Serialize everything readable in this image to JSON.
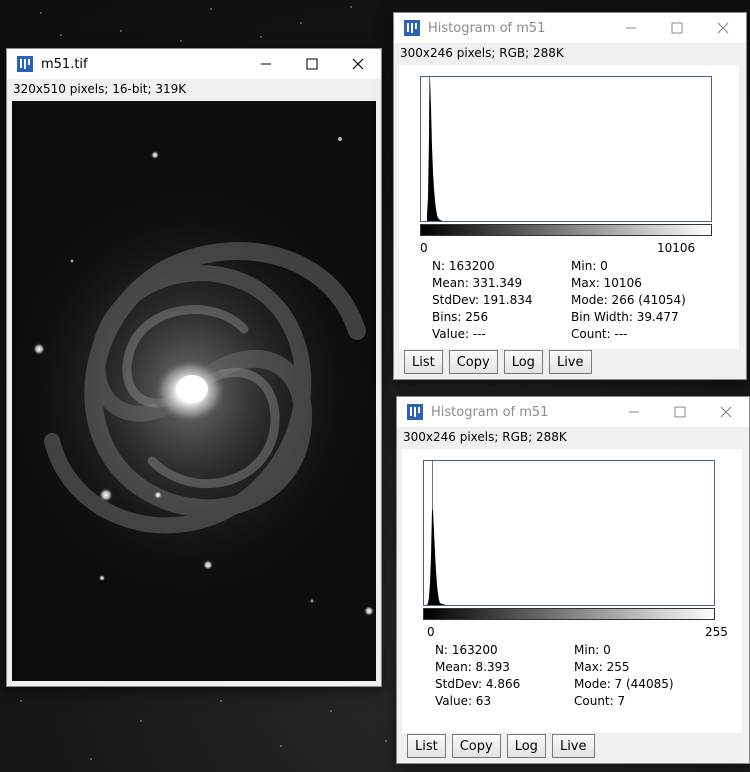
{
  "image_window": {
    "title": "m51.tif",
    "info": "320x510 pixels; 16-bit; 319K"
  },
  "histograms": [
    {
      "title": "Histogram of m51",
      "info": "300x246 pixels; RGB; 288K",
      "x_min_label": "0",
      "x_max_label": "10106",
      "stats_left": [
        "N: 163200",
        "Mean: 331.349",
        "StdDev: 191.834",
        "Bins: 256",
        "Value: ---"
      ],
      "stats_right": [
        "Min: 0",
        "Max: 10106",
        "Mode: 266 (41054)",
        "Bin Width: 39.477",
        "Count: ---"
      ],
      "buttons": [
        "List",
        "Copy",
        "Log",
        "Live"
      ]
    },
    {
      "title": "Histogram of m51",
      "info": "300x246 pixels; RGB; 288K",
      "x_min_label": "0",
      "x_max_label": "255",
      "stats_left": [
        "N: 163200",
        "Mean: 8.393",
        "StdDev: 4.866",
        "Value: 63"
      ],
      "stats_right": [
        "Min: 0",
        "Max: 255",
        "Mode: 7 (44085)",
        "Count: 7"
      ],
      "buttons": [
        "List",
        "Copy",
        "Log",
        "Live"
      ]
    }
  ]
}
